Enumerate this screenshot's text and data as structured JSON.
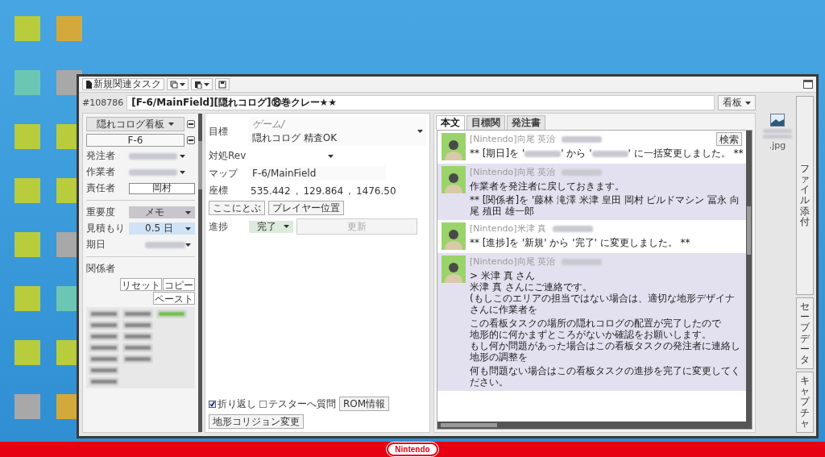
{
  "slide": {
    "squares": [
      {
        "color": "#b8cc3c"
      },
      {
        "color": "#d4a93c"
      },
      {
        "color": "#6cc6b4"
      },
      {
        "color": "#a8a8a8"
      },
      {
        "color": "#b8cc3c"
      },
      {
        "color": "#b8cc3c"
      },
      {
        "color": "#b8cc3c"
      },
      {
        "color": "#b8cc3c"
      },
      {
        "color": "#b8cc3c"
      },
      {
        "color": "#a8a8a8"
      },
      {
        "color": "#b8cc3c"
      },
      {
        "color": "#6cc6b4"
      },
      {
        "color": "#b8cc3c"
      },
      {
        "color": "#b8cc3c"
      },
      {
        "color": "#a8a8a8"
      },
      {
        "color": "#d4a93c"
      }
    ],
    "footer_logo": "Nintendo"
  },
  "window": {
    "toolbar": {
      "new_task_button": "新規関連タスク"
    },
    "task_number": "#108786",
    "title": "[F-6/MainField][隠れコログ]⑱巻クレー★★",
    "category": "看板",
    "left_panel": {
      "type_button": "隠れコログ看板",
      "area_field": "F-6",
      "people": [
        {
          "label": "発注者",
          "kind": "redacted"
        },
        {
          "label": "作業者",
          "kind": "redacted"
        },
        {
          "label": "責任者",
          "kind": "field",
          "value": "岡村"
        }
      ],
      "importance": {
        "label": "重要度",
        "value": "メモ"
      },
      "estimate": {
        "label": "見積もり",
        "value": "0.5 日"
      },
      "due": {
        "label": "期日"
      },
      "related": {
        "label": "関係者",
        "buttons": [
          "リセット",
          "コピー",
          "ペースト"
        ],
        "chip_rows": [
          [
            {
              "highlighted": false
            },
            {
              "highlighted": false
            },
            {
              "highlighted": true
            }
          ],
          [
            {
              "highlighted": false
            },
            {
              "highlighted": false
            }
          ],
          [
            {
              "highlighted": false
            },
            {
              "highlighted": false
            }
          ],
          [
            {
              "highlighted": false
            },
            {
              "highlighted": false
            }
          ],
          [
            {
              "highlighted": false
            },
            {
              "highlighted": false
            }
          ],
          [
            {
              "highlighted": false
            }
          ],
          [
            {
              "highlighted": false
            }
          ]
        ]
      }
    },
    "middle_panel": {
      "goal": {
        "label": "目標",
        "category": "ゲーム/",
        "value": "隠れコログ 精査OK"
      },
      "rev": {
        "label": "対処Rev"
      },
      "map": {
        "label": "マップ",
        "value": "F-6/MainField"
      },
      "coords": {
        "label": "座標",
        "values": [
          "535.442",
          "129.864",
          "1476.50"
        ],
        "separators": [
          ",",
          ","
        ],
        "buttons": [
          "ここにとぶ",
          "プレイヤー位置"
        ]
      },
      "progress": {
        "label": "進捗",
        "value": "完了",
        "update_button": {
          "label": "更新",
          "disabled": true
        }
      },
      "footer": {
        "checks": [
          {
            "label": "折り返し",
            "checked": true
          },
          {
            "label": "テスターへ質問",
            "checked": false
          }
        ],
        "buttons": [
          "ROM情報",
          "地形コリジョン変更"
        ]
      }
    },
    "comments_panel": {
      "tabs": [
        {
          "label": "本文",
          "selected": true
        },
        {
          "label": "目標関",
          "selected": false
        },
        {
          "label": "発注書",
          "selected": false
        }
      ],
      "search_button": "検索",
      "comments": [
        {
          "author": "[Nintendo]向尾 英治",
          "highlighted": false,
          "paragraphs": [
            [
              [
                {
                  "kind": "text",
                  "text": "** [期日]を '"
                },
                {
                  "kind": "redacted"
                },
                {
                  "kind": "text",
                  "text": "' から '"
                },
                {
                  "kind": "redacted"
                },
                {
                  "kind": "text",
                  "text": "' に一括変更しました。 **"
                }
              ]
            ]
          ]
        },
        {
          "author": "[Nintendo]向尾 英治",
          "highlighted": true,
          "paragraphs": [
            [
              [
                {
                  "kind": "text",
                  "text": "作業者を発注者に戻しておきます。"
                }
              ]
            ],
            [
              [
                {
                  "kind": "text",
                  "text": "** [関係者]を '藤林 滝澤 米津 皇田 岡村 ビルドマシン 冨永 向尾 殖田 雄一郎"
                }
              ]
            ]
          ]
        },
        {
          "author": "[Nintendo]米津 真",
          "highlighted": false,
          "paragraphs": [
            [
              [
                {
                  "kind": "text",
                  "text": "** [進捗]を '新規' から '完了' に変更しました。 **"
                }
              ]
            ]
          ]
        },
        {
          "author": "[Nintendo]向尾 英治",
          "highlighted": true,
          "paragraphs": [
            [
              [
                {
                  "kind": "text",
                  "text": "> 米津 真 さん"
                }
              ],
              [
                {
                  "kind": "text",
                  "text": "米津 真 さんにご連絡です。"
                }
              ],
              [
                {
                  "kind": "text",
                  "text": "(もしこのエリアの担当ではない場合は、適切な地形デザイナさんに作業者を"
                }
              ]
            ],
            [
              [
                {
                  "kind": "text",
                  "text": "この看板タスクの場所の隠れコログの配置が完了したので"
                }
              ],
              [
                {
                  "kind": "text",
                  "text": "地形的に何かまずところがないか確認をお願いします。"
                }
              ],
              [
                {
                  "kind": "text",
                  "text": "もし何か問題があった場合はこの看板タスクの発注者に連絡し地形の調整を"
                }
              ]
            ],
            [
              [
                {
                  "kind": "text",
                  "text": "何も問題ない場合はこの看板タスクの進捗を完了に変更してください。"
                }
              ]
            ]
          ]
        }
      ]
    },
    "attachment": {
      "filename": ".jpg"
    },
    "side_tabs": [
      "ファイル添付",
      "セーブデータ",
      "キャプチャ"
    ]
  }
}
